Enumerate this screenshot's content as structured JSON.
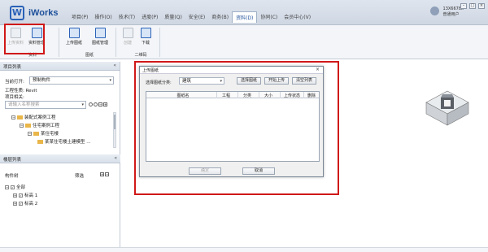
{
  "app": {
    "name": "iWorks",
    "logo_letter": "W"
  },
  "tabs": [
    {
      "label": "项目(P)",
      "active": false
    },
    {
      "label": "操作(O)",
      "active": false
    },
    {
      "label": "技术(T)",
      "active": false
    },
    {
      "label": "进度(P)",
      "active": false
    },
    {
      "label": "质量(Q)",
      "active": false
    },
    {
      "label": "安全(E)",
      "active": false
    },
    {
      "label": "商务(B)",
      "active": false
    },
    {
      "label": "资料(D)",
      "active": true
    },
    {
      "label": "协同(C)",
      "active": false
    },
    {
      "label": "会员中心(V)",
      "active": false
    }
  ],
  "user": {
    "id": "13X6678x",
    "role": "普通用户"
  },
  "window_controls": {
    "minimize": "–",
    "maximize": "□",
    "close": "×"
  },
  "ribbon": {
    "groups": [
      {
        "label": "资料",
        "buttons": [
          {
            "label": "上传资料",
            "disabled": true
          },
          {
            "label": "资料管理",
            "disabled": false
          }
        ]
      },
      {
        "label": "图纸",
        "buttons": [
          {
            "label": "上传图纸",
            "disabled": false
          },
          {
            "label": "图纸管理",
            "disabled": false
          }
        ]
      },
      {
        "label": "二维码",
        "buttons": [
          {
            "label": "创建",
            "disabled": true
          },
          {
            "label": "下载",
            "disabled": false
          }
        ]
      }
    ]
  },
  "project_panel": {
    "title": "项目列表",
    "current_label": "当前打开:",
    "current_value": "预制构件",
    "engineering_label": "工程性质:",
    "engineering_value": "Revit",
    "project_related_label": "项目相关:",
    "search_placeholder": "请输入名称搜索",
    "tree": [
      {
        "label": "装配式案例工程",
        "level": 0
      },
      {
        "label": "住宅案例工程",
        "level": 1
      },
      {
        "label": "某住宅楼",
        "level": 2
      },
      {
        "label": "某某住宅楼土建模型 ...",
        "level": 3
      }
    ]
  },
  "layer_panel": {
    "title": "楼层列表",
    "component_label": "构件树",
    "filter_label": "筛选",
    "tree": [
      {
        "label": "全部",
        "level": 0
      },
      {
        "label": "标高 1",
        "level": 1
      },
      {
        "label": "标高 2",
        "level": 1
      }
    ]
  },
  "dialog": {
    "title": "上传图纸",
    "category_label": "选择图纸分类:",
    "category_value": "建筑",
    "select_button": "选择图纸",
    "start_button": "开始上传",
    "clear_button": "清空列表",
    "columns": [
      "图纸名",
      "工程",
      "分类",
      "大小",
      "上传状态",
      "删除"
    ],
    "confirm_button": "确定",
    "cancel_button": "取消"
  },
  "colors": {
    "accent": "#1d4f9a",
    "highlight": "#d01818"
  }
}
